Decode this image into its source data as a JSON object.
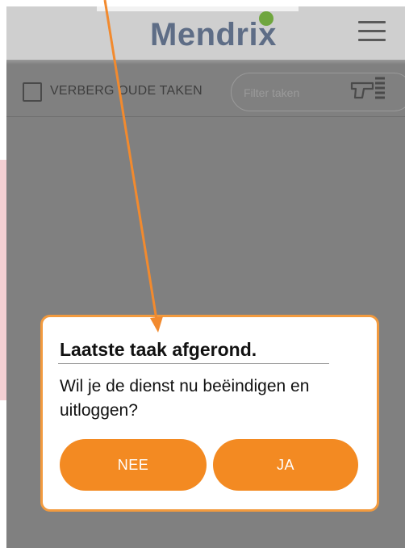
{
  "app": {
    "logo_text": "Mendrix",
    "logo_dot_color": "#6fa63e",
    "header_background": "#cfcfcf"
  },
  "filter_bar": {
    "checkbox_label": "VERBERG OUDE TAKEN",
    "checkbox_checked": false,
    "search_placeholder": "Filter taken",
    "search_value": "",
    "scanner_icon": "barcode-scanner-icon"
  },
  "menu": {
    "icon": "hamburger-menu-icon"
  },
  "dialog": {
    "title": "Laatste taak afgerond.",
    "message": "Wil je de dienst nu beëindigen en uitloggen?",
    "no_label": "NEE",
    "yes_label": "JA",
    "border_color": "#f29a3e",
    "button_color": "#f38a22"
  },
  "annotation": {
    "arrow_color": "#f28a2e",
    "arrow_icon": "pointer-arrow"
  },
  "overlay_color": "#808080"
}
